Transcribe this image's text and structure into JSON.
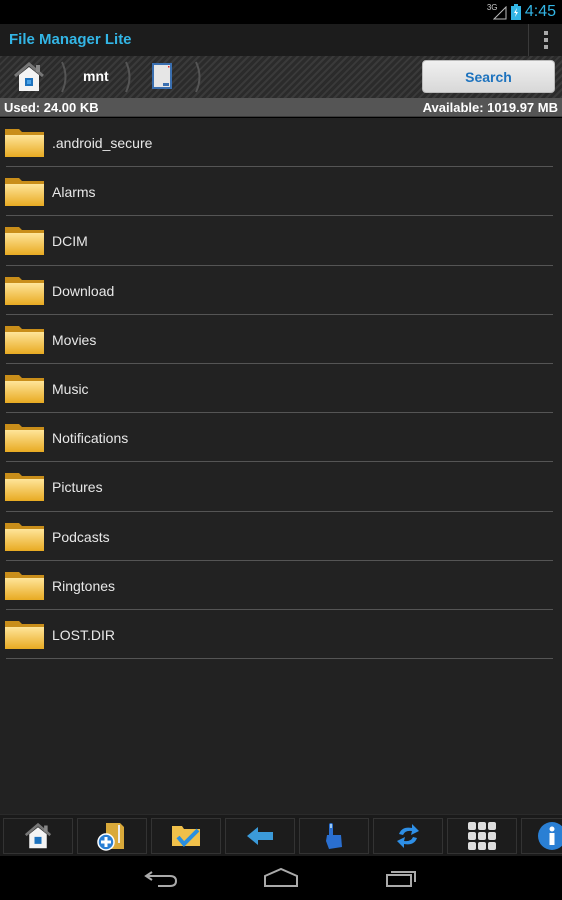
{
  "status_bar": {
    "network": "3G",
    "time": "4:45",
    "icons": [
      "signal-icon",
      "battery-charging-icon"
    ]
  },
  "action_bar": {
    "title": "File Manager Lite",
    "overflow_icon": "overflow-menu-icon"
  },
  "breadcrumb": {
    "items": [
      {
        "type": "icon",
        "icon": "home-icon"
      },
      {
        "type": "text",
        "label": "mnt"
      },
      {
        "type": "icon",
        "icon": "sd-card-icon"
      }
    ],
    "search_label": "Search"
  },
  "usage": {
    "used": "Used: 24.00 KB",
    "available": "Available: 1019.97 MB"
  },
  "files": [
    {
      "name": ".android_secure",
      "icon": "folder-icon"
    },
    {
      "name": "Alarms",
      "icon": "folder-icon"
    },
    {
      "name": "DCIM",
      "icon": "folder-icon"
    },
    {
      "name": "Download",
      "icon": "folder-icon"
    },
    {
      "name": "Movies",
      "icon": "folder-icon"
    },
    {
      "name": "Music",
      "icon": "folder-icon"
    },
    {
      "name": "Notifications",
      "icon": "folder-icon"
    },
    {
      "name": "Pictures",
      "icon": "folder-icon"
    },
    {
      "name": "Podcasts",
      "icon": "folder-icon"
    },
    {
      "name": "Ringtones",
      "icon": "folder-icon"
    },
    {
      "name": "LOST.DIR",
      "icon": "folder-icon"
    }
  ],
  "toolbar": {
    "buttons": [
      {
        "icon": "home-icon"
      },
      {
        "icon": "new-folder-icon"
      },
      {
        "icon": "select-folder-icon"
      },
      {
        "icon": "back-arrow-icon"
      },
      {
        "icon": "pointer-hand-icon"
      },
      {
        "icon": "refresh-icon"
      },
      {
        "icon": "grid-view-icon"
      },
      {
        "icon": "info-icon"
      }
    ]
  },
  "nav_bar": {
    "buttons": [
      "back-icon",
      "home-icon",
      "recent-apps-icon"
    ]
  }
}
